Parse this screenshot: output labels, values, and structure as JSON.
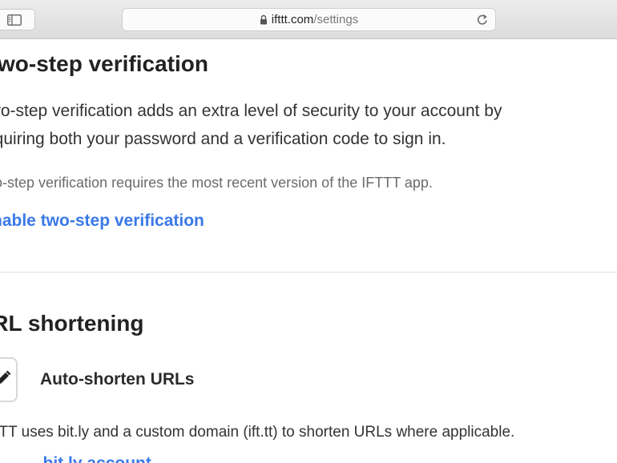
{
  "browser": {
    "url_domain": "ifttt.com",
    "url_path": "/settings"
  },
  "two_step": {
    "heading": "Two-step verification",
    "description_line1": "Two-step verification adds an extra level of security to your account by",
    "description_line2": "requiring both your password and a verification code to sign in.",
    "note": "Two-step verification requires the most recent version of the IFTTT app.",
    "enable_link": "Enable two-step verification"
  },
  "url_shortening": {
    "heading": "URL shortening",
    "option_label": "Auto-shorten URLs",
    "description": "IFTTT uses bit.ly and a custom domain (ift.tt) to shorten URLs where applicable.",
    "partial_link": "...bit.ly account..."
  },
  "colors": {
    "link": "#3a79e8",
    "heading": "#222222",
    "muted": "#6b6b6b"
  }
}
